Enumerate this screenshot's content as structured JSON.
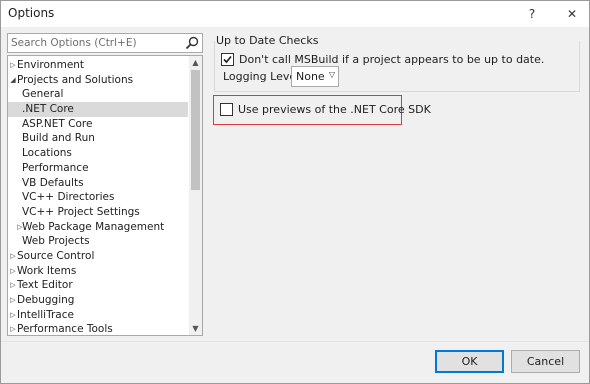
{
  "window": {
    "title": "Options",
    "help_glyph": "?",
    "close_glyph": "✕"
  },
  "search": {
    "placeholder": "Search Options (Ctrl+E)",
    "value": ""
  },
  "tree": {
    "items": [
      {
        "label": "Environment",
        "expander": "▷",
        "indent": 0
      },
      {
        "label": "Projects and Solutions",
        "expander": "◢",
        "indent": 0
      },
      {
        "label": "General",
        "expander": "",
        "indent": 1
      },
      {
        "label": ".NET Core",
        "expander": "",
        "indent": 1,
        "selected": true
      },
      {
        "label": "ASP.NET Core",
        "expander": "",
        "indent": 1
      },
      {
        "label": "Build and Run",
        "expander": "",
        "indent": 1
      },
      {
        "label": "Locations",
        "expander": "",
        "indent": 1
      },
      {
        "label": "Performance",
        "expander": "",
        "indent": 1
      },
      {
        "label": "VB Defaults",
        "expander": "",
        "indent": 1
      },
      {
        "label": "VC++ Directories",
        "expander": "",
        "indent": 1
      },
      {
        "label": "VC++ Project Settings",
        "expander": "",
        "indent": 1
      },
      {
        "label": "Web Package Management",
        "expander": "▷",
        "indent": 1
      },
      {
        "label": "Web Projects",
        "expander": "",
        "indent": 1
      },
      {
        "label": "Source Control",
        "expander": "▷",
        "indent": 0
      },
      {
        "label": "Work Items",
        "expander": "▷",
        "indent": 0
      },
      {
        "label": "Text Editor",
        "expander": "▷",
        "indent": 0
      },
      {
        "label": "Debugging",
        "expander": "▷",
        "indent": 0
      },
      {
        "label": "IntelliTrace",
        "expander": "▷",
        "indent": 0
      },
      {
        "label": "Performance Tools",
        "expander": "▷",
        "indent": 0
      }
    ],
    "scroll_up_glyph": "▲",
    "scroll_down_glyph": "▼"
  },
  "up_to_date": {
    "group_title": "Up to Date Checks",
    "dont_call_msbuild_label": "Don't call MSBuild if a project appears to be up to date.",
    "dont_call_msbuild_checked": true,
    "logging_level_label": "Logging Level:",
    "logging_level_value": "None",
    "dropdown_glyph": "▽"
  },
  "previews": {
    "label": "Use previews of the .NET Core SDK",
    "checked": false
  },
  "buttons": {
    "ok": "OK",
    "cancel": "Cancel"
  },
  "colors": {
    "highlight_border": "#e0383a",
    "default_button_border": "#0078d7",
    "selected_row": "#dadada"
  }
}
